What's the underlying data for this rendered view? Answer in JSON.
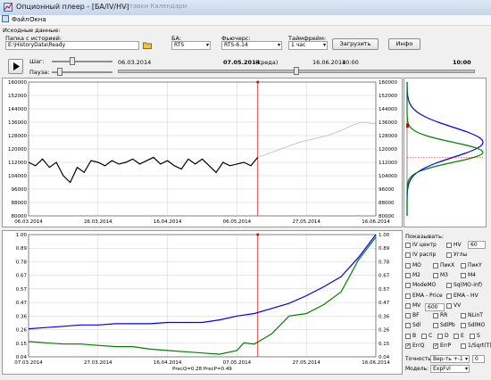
{
  "window": {
    "title": "Опционный плеер - [БА/IV/HV]",
    "background_app_text": "Ставки   Календари"
  },
  "menu": [
    "Файл",
    "Окна"
  ],
  "controls": {
    "source_section": "Исходные данные:",
    "history_folder_label": "Папка с историей:",
    "history_folder_value": "E:\\HistoryData\\Ready",
    "ba_label": "БА:",
    "ba_value": "RTS",
    "futures_label": "Фьючерс:",
    "futures_value": "RTS-6.14",
    "timeframe_label": "Таймфрейм:",
    "timeframe_value": "1 час",
    "load_button": "Загрузить",
    "info_button": "Инфо"
  },
  "player": {
    "step_label": "Шаг:",
    "pause_label": "Пауза:",
    "start_date": "06.03.2014",
    "current_date": "07.05.2014",
    "current_day": "(среда)",
    "end_date": "16.06.2014",
    "end_time": "10:00",
    "current_time": "10:00",
    "progress": 0.5
  },
  "chart_data": [
    {
      "type": "line",
      "title": "",
      "y_ticks": [
        "160000",
        "152000",
        "144000",
        "136000",
        "128000",
        "120000",
        "112000",
        "104000",
        "96000",
        "88000",
        "80000"
      ],
      "x_ticks": [
        "06.03.2014",
        "26.03.2014",
        "16.04.2014",
        "06.05.2014",
        "27.05.2014",
        "16.06.2014"
      ],
      "ylim": [
        80000,
        160000
      ],
      "cursor_date": "06.05.2014",
      "series": [
        {
          "color": "#000000",
          "points": [
            [
              0,
              112000
            ],
            [
              0.02,
              110000
            ],
            [
              0.04,
              114000
            ],
            [
              0.06,
              109000
            ],
            [
              0.08,
              112000
            ],
            [
              0.1,
              104000
            ],
            [
              0.12,
              100000
            ],
            [
              0.14,
              109000
            ],
            [
              0.16,
              106000
            ],
            [
              0.18,
              113000
            ],
            [
              0.2,
              112000
            ],
            [
              0.22,
              110000
            ],
            [
              0.24,
              113000
            ],
            [
              0.26,
              111000
            ],
            [
              0.28,
              112000
            ],
            [
              0.3,
              114000
            ],
            [
              0.32,
              111000
            ],
            [
              0.34,
              113000
            ],
            [
              0.36,
              115000
            ],
            [
              0.38,
              111000
            ],
            [
              0.4,
              113000
            ],
            [
              0.42,
              110000
            ],
            [
              0.44,
              108000
            ],
            [
              0.46,
              114000
            ],
            [
              0.48,
              111000
            ],
            [
              0.5,
              114000
            ],
            [
              0.52,
              110000
            ],
            [
              0.54,
              106000
            ],
            [
              0.56,
              112000
            ],
            [
              0.58,
              110000
            ],
            [
              0.6,
              111000
            ],
            [
              0.62,
              112000
            ],
            [
              0.64,
              110000
            ],
            [
              0.66,
              115000
            ]
          ]
        },
        {
          "color": "#bbbbbb",
          "points": [
            [
              0.66,
              115000
            ],
            [
              0.7,
              118000
            ],
            [
              0.74,
              121000
            ],
            [
              0.78,
              124000
            ],
            [
              0.82,
              126000
            ],
            [
              0.86,
              128000
            ],
            [
              0.9,
              131000
            ],
            [
              0.93,
              134000
            ],
            [
              0.96,
              136000
            ],
            [
              1,
              135000
            ]
          ]
        }
      ]
    },
    {
      "type": "line",
      "title": "",
      "y_ticks": [
        "1.00",
        "0.89",
        "0.78",
        "0.67",
        "0.57",
        "0.47",
        "0.36",
        "0.26",
        "0.15",
        "0.04"
      ],
      "x_ticks": [
        "07.03.2014",
        "27.03.2014",
        "16.04.2014",
        "07.05.2014",
        "27.05.2014",
        "16.06.2014"
      ],
      "ylim": [
        0.04,
        1.0
      ],
      "cursor_date": "07.05.2014",
      "caption": "PrecQ=0.28  PrecP=0.49",
      "series": [
        {
          "color": "#0000ee",
          "points": [
            [
              0,
              0.26
            ],
            [
              0.05,
              0.27
            ],
            [
              0.1,
              0.28
            ],
            [
              0.15,
              0.29
            ],
            [
              0.2,
              0.29
            ],
            [
              0.25,
              0.3
            ],
            [
              0.3,
              0.3
            ],
            [
              0.35,
              0.3
            ],
            [
              0.4,
              0.31
            ],
            [
              0.45,
              0.31
            ],
            [
              0.5,
              0.31
            ],
            [
              0.55,
              0.33
            ],
            [
              0.6,
              0.36
            ],
            [
              0.65,
              0.38
            ],
            [
              0.7,
              0.42
            ],
            [
              0.75,
              0.46
            ],
            [
              0.8,
              0.52
            ],
            [
              0.85,
              0.59
            ],
            [
              0.9,
              0.67
            ],
            [
              0.95,
              0.82
            ],
            [
              1,
              1.0
            ]
          ]
        },
        {
          "color": "#008000",
          "points": [
            [
              0,
              0.16
            ],
            [
              0.05,
              0.15
            ],
            [
              0.1,
              0.14
            ],
            [
              0.15,
              0.14
            ],
            [
              0.2,
              0.13
            ],
            [
              0.25,
              0.12
            ],
            [
              0.3,
              0.12
            ],
            [
              0.35,
              0.1
            ],
            [
              0.4,
              0.09
            ],
            [
              0.45,
              0.08
            ],
            [
              0.5,
              0.07
            ],
            [
              0.55,
              0.06
            ],
            [
              0.6,
              0.09
            ],
            [
              0.62,
              0.15
            ],
            [
              0.65,
              0.14
            ],
            [
              0.7,
              0.22
            ],
            [
              0.75,
              0.36
            ],
            [
              0.8,
              0.38
            ],
            [
              0.85,
              0.45
            ],
            [
              0.9,
              0.55
            ],
            [
              0.95,
              0.8
            ],
            [
              1,
              0.98
            ]
          ]
        }
      ]
    },
    {
      "type": "distribution",
      "title": "",
      "ylim": [
        80000,
        160000
      ],
      "series": [
        {
          "color": "#0000ee",
          "mean": 124000,
          "sd": 9000
        },
        {
          "color": "#008000",
          "mean": 118000,
          "sd": 6000
        }
      ],
      "current_price": 115000
    }
  ],
  "show_panel": {
    "title": "Показывать:",
    "options": [
      {
        "label": "IV центр",
        "checked": false
      },
      {
        "label": "HV",
        "checked": false
      },
      {
        "label": "IV распр",
        "checked": false
      },
      {
        "label": "Углы",
        "checked": false
      },
      {
        "label": "MO",
        "checked": false
      },
      {
        "label": "ПикХ",
        "checked": false
      },
      {
        "label": "ПикY",
        "checked": false
      },
      {
        "label": "M2",
        "checked": false
      },
      {
        "label": "M3",
        "checked": false
      },
      {
        "label": "M4",
        "checked": false
      },
      {
        "label": "ModeMO",
        "checked": false
      },
      {
        "label": "Sq(MO-inf)",
        "checked": false
      },
      {
        "label": "EMA - Price",
        "checked": false
      },
      {
        "label": "EMA - HV",
        "checked": false
      },
      {
        "label": "MV",
        "checked": false
      },
      {
        "label": "VV",
        "checked": false
      },
      {
        "label": "BF",
        "checked": false
      },
      {
        "label": "RR",
        "checked": false
      },
      {
        "label": "NLinT",
        "checked": false
      },
      {
        "label": "Sdl",
        "checked": false
      },
      {
        "label": "SdlPb",
        "checked": false
      },
      {
        "label": "SdlMO",
        "checked": false
      },
      {
        "label": "B",
        "checked": false
      },
      {
        "label": "C",
        "checked": false
      },
      {
        "label": "D",
        "checked": false
      },
      {
        "label": "E",
        "checked": false
      },
      {
        "label": "S",
        "checked": false
      },
      {
        "label": "ErrQ",
        "checked": true
      },
      {
        "label": "ErrP",
        "checked": true
      },
      {
        "label": "1/Sqrt(T)",
        "checked": false
      }
    ],
    "hv_value": "60",
    "mv_value": "600",
    "accuracy_label": "Точность:",
    "accuracy_value": "Вер-ть +-1",
    "accuracy_num": "0",
    "model_label": "Модель:",
    "model_value": "ExpFvl"
  }
}
